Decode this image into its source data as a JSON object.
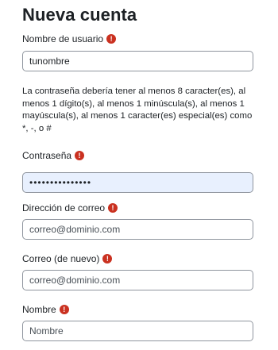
{
  "form": {
    "title": "Nueva cuenta",
    "username": {
      "label": "Nombre de usuario",
      "value": "tunombre",
      "placeholder": ""
    },
    "password_hint": "La contraseña debería tener al menos 8 caracter(es), al menos 1 dígito(s), al menos 1 minúscula(s), al menos 1 mayúscula(s), al menos 1 caracter(es) especial(es) como *, -, o #",
    "password": {
      "label": "Contraseña",
      "value": "•••••••••••••••"
    },
    "email": {
      "label": "Dirección de correo",
      "placeholder": "correo@dominio.com"
    },
    "email_again": {
      "label": "Correo (de nuevo)",
      "placeholder": "correo@dominio.com"
    },
    "first_name": {
      "label": "Nombre",
      "placeholder": "Nombre"
    },
    "required_icon_glyph": "!",
    "required_color": "#ca3120"
  }
}
